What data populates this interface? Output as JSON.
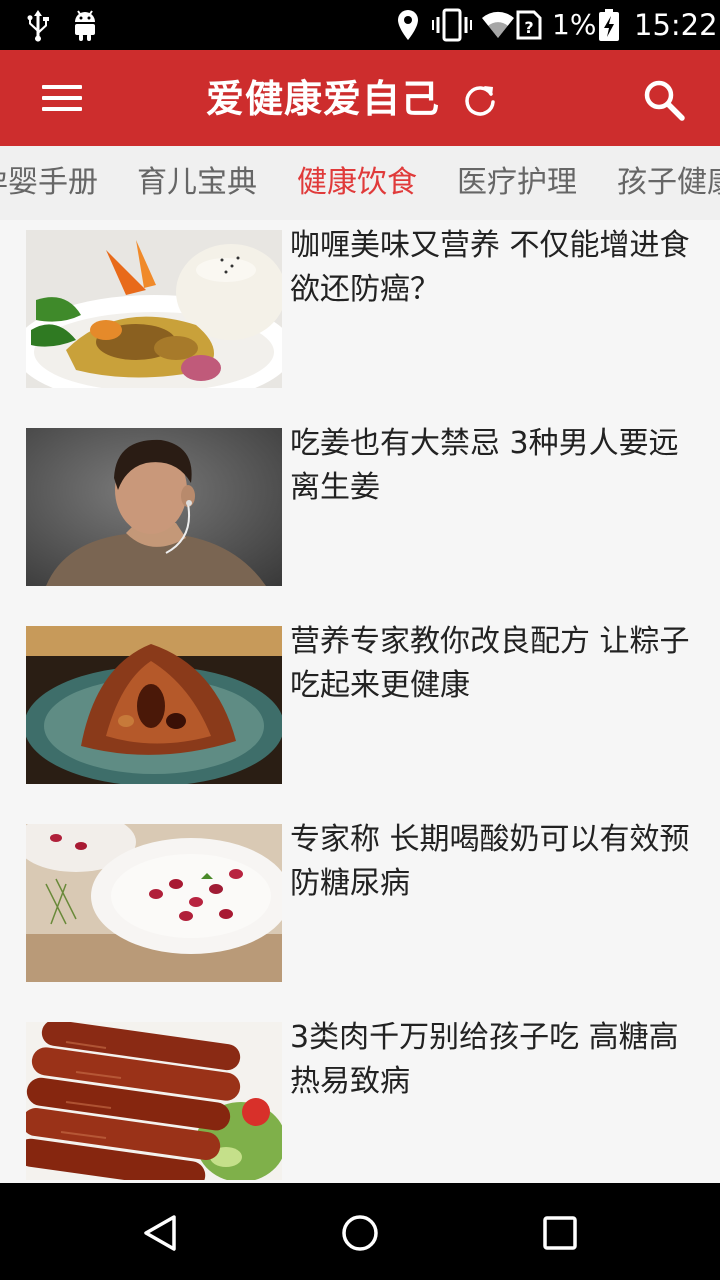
{
  "status_bar": {
    "battery_percent": "1%",
    "time": "15:22",
    "icons": [
      "usb-icon",
      "android-icon",
      "location-icon",
      "vibrate-icon",
      "wifi-icon",
      "no-sim-icon",
      "battery-charging-icon"
    ]
  },
  "app_bar": {
    "title": "爱健康爱自己",
    "icons": [
      "menu-icon",
      "refresh-icon",
      "search-icon"
    ]
  },
  "tabs": [
    {
      "label": "孕婴手册",
      "active": false
    },
    {
      "label": "育儿宝典",
      "active": false
    },
    {
      "label": "健康饮食",
      "active": true
    },
    {
      "label": "医疗护理",
      "active": false
    },
    {
      "label": "孩子健康",
      "active": false
    }
  ],
  "colors": {
    "app_bar": "#cd2d2d",
    "active_tab": "#e03a3a",
    "tab_text": "#666666",
    "title_text": "#222222"
  },
  "articles": [
    {
      "title": "咖喱美味又营养 不仅能增进食欲还防癌？",
      "thumbnail": "curry-rice-photo"
    },
    {
      "title": "吃姜也有大禁忌 3种男人要远离生姜",
      "thumbnail": "man-with-earphones-photo"
    },
    {
      "title": "营养专家教你改良配方 让粽子吃起来更健康",
      "thumbnail": "zongzi-photo"
    },
    {
      "title": "专家称 长期喝酸奶可以有效预防糖尿病",
      "thumbnail": "yogurt-berries-photo"
    },
    {
      "title": "3类肉千万别给孩子吃 高糖高热易致病",
      "thumbnail": "sausages-photo"
    }
  ],
  "nav_bar": {
    "icons": [
      "back-icon",
      "home-icon",
      "recents-icon"
    ]
  }
}
